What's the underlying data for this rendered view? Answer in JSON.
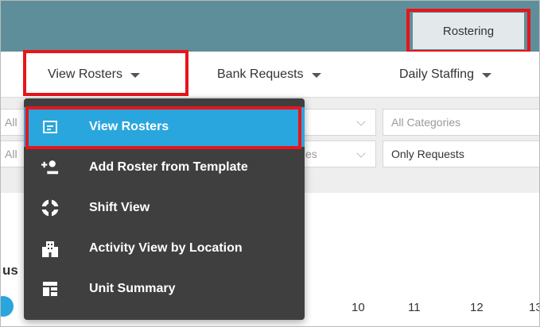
{
  "header": {
    "tab_label": "Rostering"
  },
  "subnav": {
    "items": [
      {
        "label": "View Rosters"
      },
      {
        "label": "Bank Requests"
      },
      {
        "label": "Daily Staffing"
      }
    ]
  },
  "filters": {
    "field1_value": "All",
    "field2_value": "All",
    "field3_partial": "es",
    "categories_value": "All Categories",
    "requests_value": "Only Requests"
  },
  "background": {
    "partial_text": "us",
    "days": [
      "10",
      "11",
      "12",
      "13"
    ]
  },
  "dropdown": {
    "items": [
      {
        "label": "View Rosters",
        "icon": "roster-list-icon"
      },
      {
        "label": "Add Roster from Template",
        "icon": "add-person-icon"
      },
      {
        "label": "Shift View",
        "icon": "lifebuoy-icon"
      },
      {
        "label": "Activity View by Location",
        "icon": "building-icon"
      },
      {
        "label": "Unit Summary",
        "icon": "dashboard-grid-icon"
      }
    ]
  },
  "colors": {
    "header_bg": "#5f8e9b",
    "highlight_red": "#e8141b",
    "menu_bg": "#3f3f3f",
    "menu_active": "#29a6dd"
  }
}
